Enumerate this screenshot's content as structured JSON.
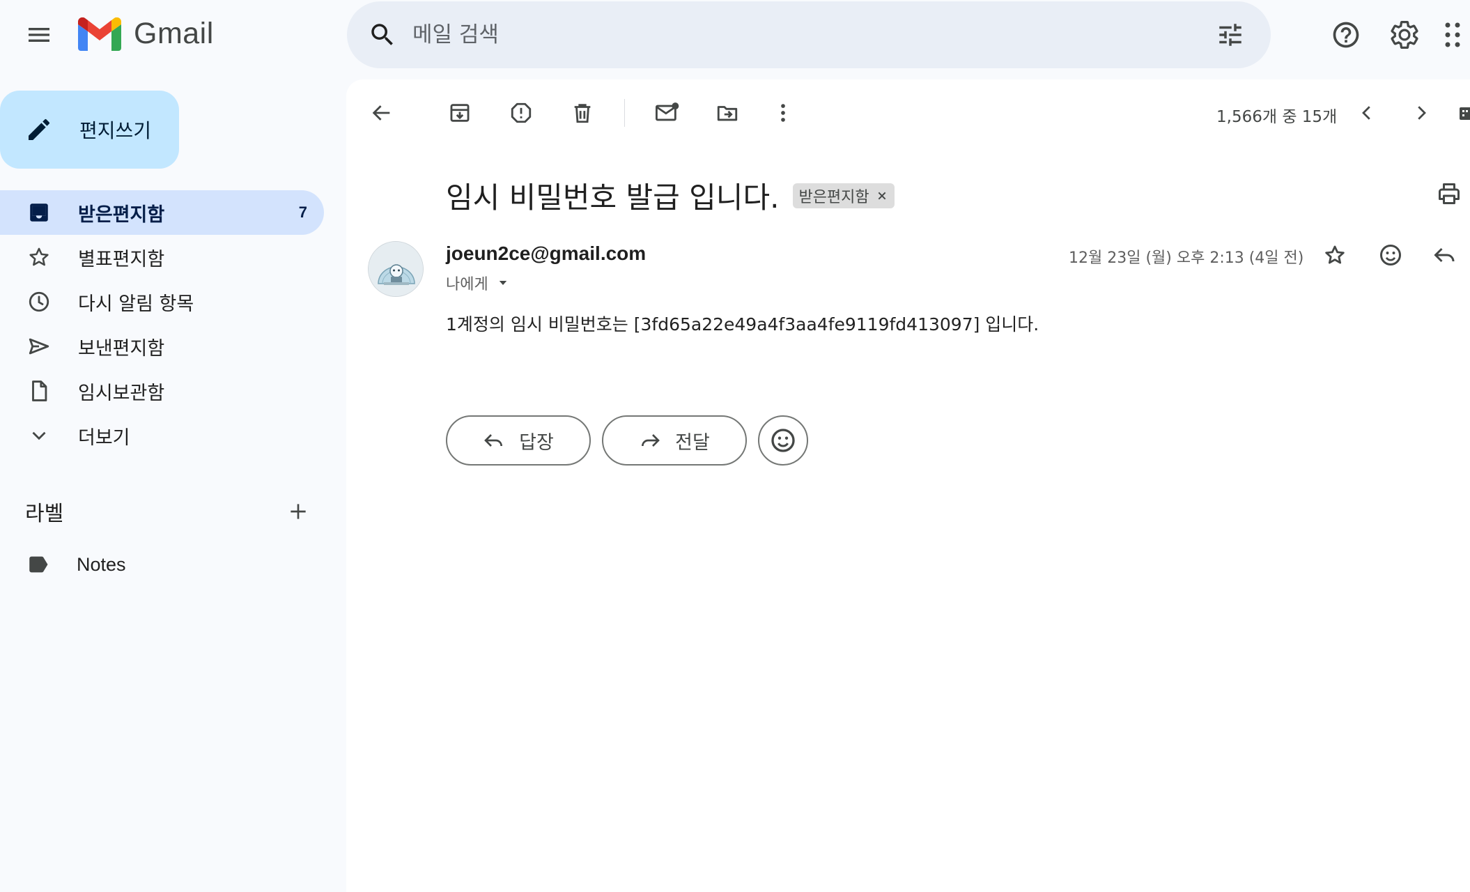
{
  "app": {
    "name": "Gmail"
  },
  "search": {
    "placeholder": "메일 검색"
  },
  "compose": {
    "label": "편지쓰기"
  },
  "sidebar": {
    "items": [
      {
        "label": "받은편지함",
        "count": "7",
        "icon": "inbox-icon"
      },
      {
        "label": "별표편지함",
        "icon": "star-icon"
      },
      {
        "label": "다시 알림 항목",
        "icon": "clock-icon"
      },
      {
        "label": "보낸편지함",
        "icon": "send-icon"
      },
      {
        "label": "임시보관함",
        "icon": "file-icon"
      },
      {
        "label": "더보기",
        "icon": "chevron-down-icon"
      }
    ],
    "labels_heading": "라벨",
    "labels": [
      {
        "label": "Notes",
        "icon": "label-icon"
      }
    ]
  },
  "toolbar": {
    "pager": "1,566개 중 15개"
  },
  "email": {
    "subject": "임시 비밀번호 발급 입니다.",
    "chip": "받은편지함",
    "sender": "joeun2ce@gmail.com",
    "to": "나에게",
    "date": "12월 23일 (월) 오후 2:13 (4일 전)",
    "body": "1계정의 임시 비밀번호는 [3fd65a22e49a4f3aa4fe9119fd413097] 입니다."
  },
  "actions": {
    "reply": "답장",
    "forward": "전달"
  },
  "colors": {
    "accent": "#c2e7ff",
    "active_nav": "#d3e3fd",
    "search_bg": "#e9eef6"
  }
}
